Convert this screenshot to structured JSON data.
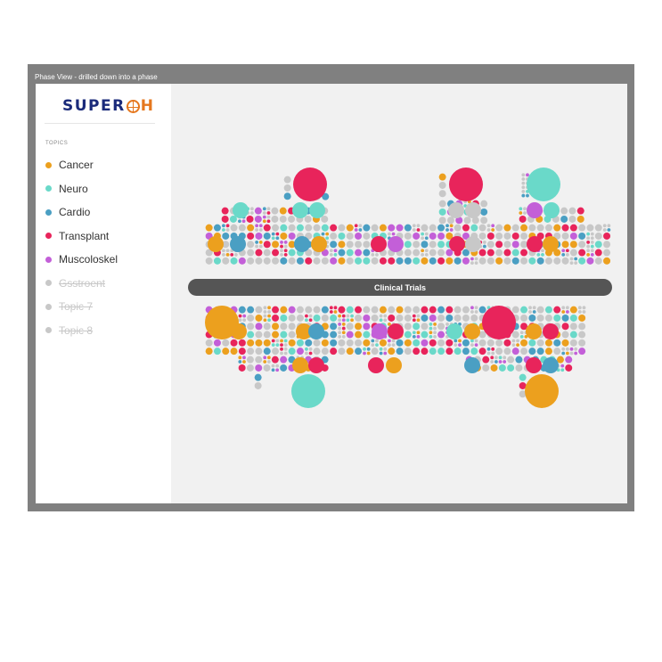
{
  "window": {
    "title": "Phase View - drilled down into a phase"
  },
  "brand": {
    "name_part1": "SUPER",
    "name_part2": "H"
  },
  "sidebar": {
    "topics_label": "TOPICS",
    "topics": [
      {
        "label": "Cancer",
        "color": "#eca01e",
        "enabled": true
      },
      {
        "label": "Neuro",
        "color": "#6ad9c9",
        "enabled": true
      },
      {
        "label": "Cardio",
        "color": "#4a9fc3",
        "enabled": true
      },
      {
        "label": "Transplant",
        "color": "#e8245b",
        "enabled": true
      },
      {
        "label": "Muscoloskel",
        "color": "#c35fd8",
        "enabled": true
      },
      {
        "label": "Gsstroent",
        "color": "#c8c8c8",
        "enabled": false
      },
      {
        "label": "Topic 7",
        "color": "#c8c8c8",
        "enabled": false
      },
      {
        "label": "Topic 8",
        "color": "#c8c8c8",
        "enabled": false
      }
    ]
  },
  "phase": {
    "label": "Clinical Trials",
    "bar_color": "#555555"
  },
  "colors": {
    "neutral": "#c8c8c8",
    "background": "#f1f1f1"
  }
}
